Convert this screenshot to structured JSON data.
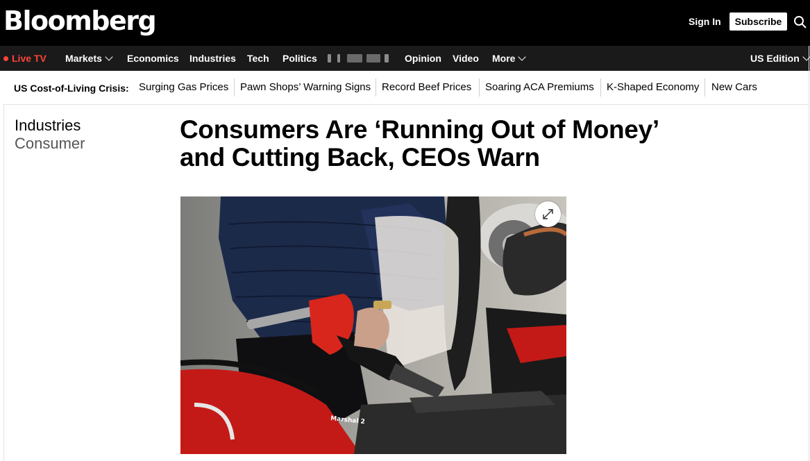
{
  "header": {
    "logo": "Bloomberg",
    "sign_in": "Sign In",
    "subscribe": "Subscribe"
  },
  "nav": {
    "live_tv": "Live TV",
    "items": [
      "Markets",
      "Economics",
      "Industries",
      "Tech",
      "Politics",
      "Opinion",
      "Video",
      "More"
    ],
    "edition": "US Edition"
  },
  "topics": {
    "heading": "US Cost-of-Living Crisis:",
    "links": [
      "Surging Gas Prices",
      "Pawn Shops’ Warning Signs",
      "Record Beef Prices",
      "Soaring ACA Premiums",
      "K-Shaped Economy",
      "New Cars"
    ]
  },
  "article": {
    "category": "Industries",
    "subcategory": "Consumer",
    "headline": "Consumers Are ‘Running Out of Money’ and Cutting Back, CEOs Warn",
    "photo_text": "Marshal 2"
  },
  "colors": {
    "live_red": "#ff4438",
    "header_bg": "#000000",
    "nav_bg": "#1a1a1a"
  },
  "icons": {
    "search": "search-icon",
    "chevron": "chevron-down-icon",
    "expand": "expand-icon"
  }
}
